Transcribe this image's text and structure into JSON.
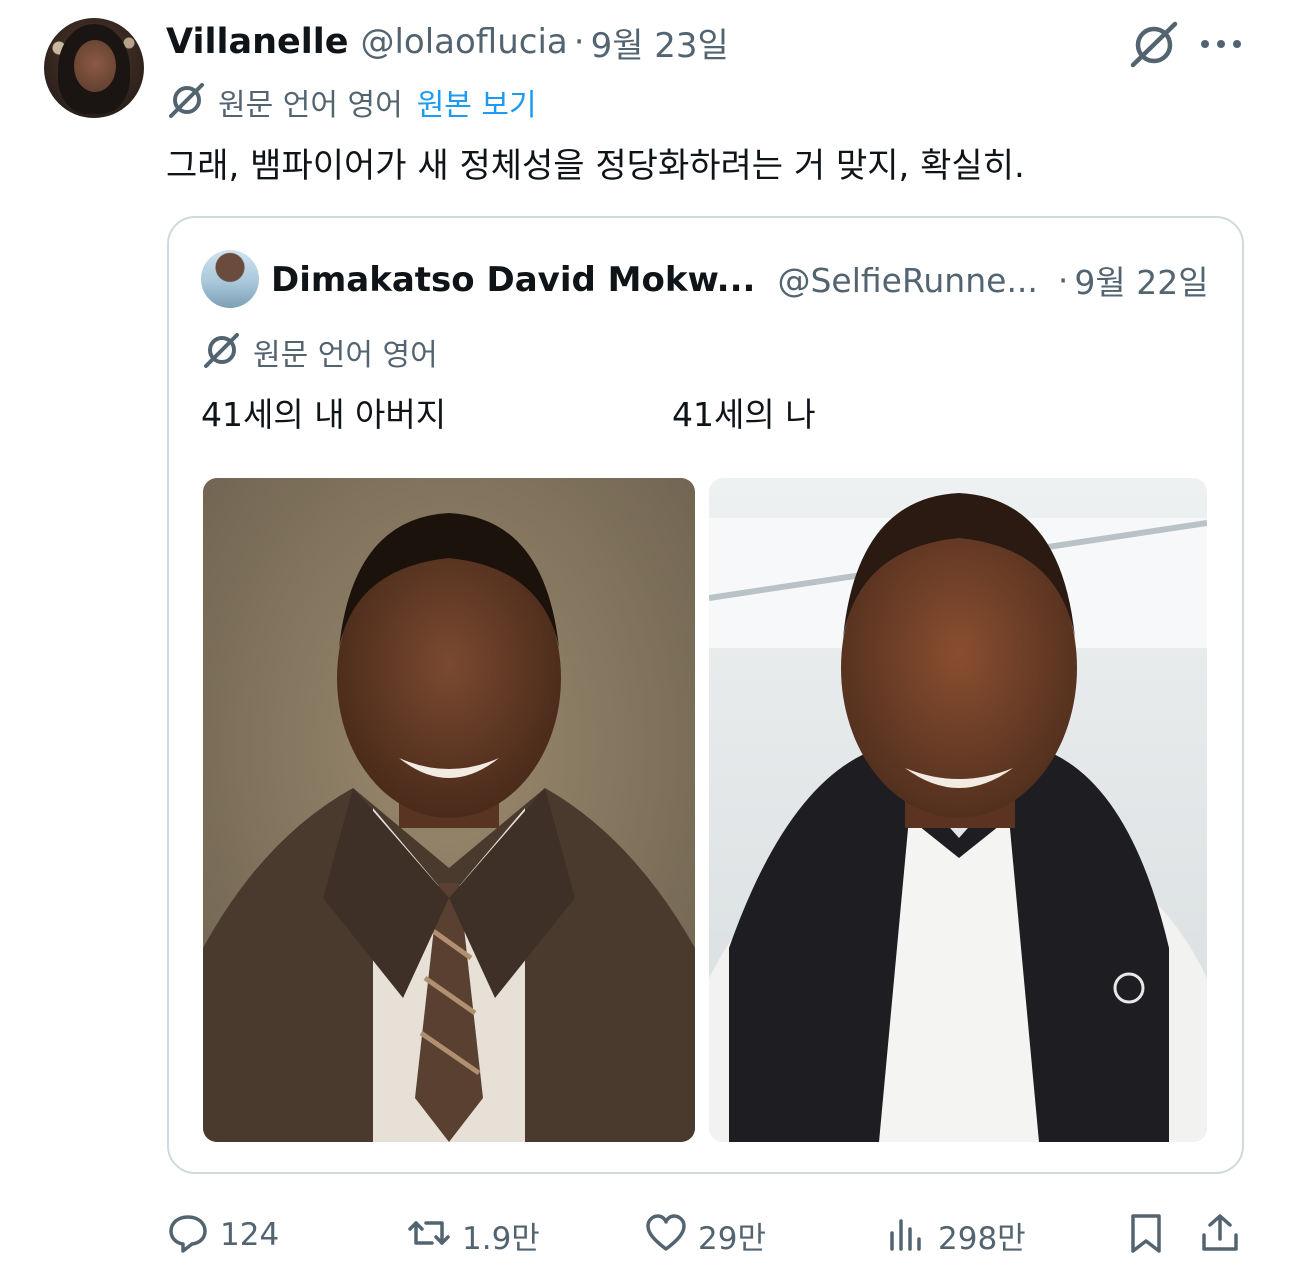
{
  "tweet": {
    "author_name": "Villanelle",
    "handle": "@lolaoflucia",
    "separator": "·",
    "date": "9월 23일",
    "language_note": "원문 언어 영어",
    "view_original": "원본 보기",
    "text": "그래, 뱀파이어가 새 정체성을 정당화하려는 거 맞지, 확실히."
  },
  "quote": {
    "author_name": "Dimakatso David Mokw...",
    "handle": "@SelfieRunne...",
    "separator": "·",
    "date": "9월 22일",
    "language_note": "원문 언어 영어",
    "caption_left": "41세의 내 아버지",
    "caption_right": "41세의 나"
  },
  "actions": {
    "replies": "124",
    "reposts": "1.9만",
    "likes": "29만",
    "views": "298만"
  },
  "colors": {
    "text_primary": "#0f1419",
    "text_secondary": "#536471",
    "link": "#1d9bf0",
    "border": "#cfd9de"
  },
  "icons": [
    "grok-icon",
    "more-icon",
    "translate-icon",
    "reply-icon",
    "repost-icon",
    "like-icon",
    "views-icon",
    "bookmark-icon",
    "share-icon"
  ]
}
